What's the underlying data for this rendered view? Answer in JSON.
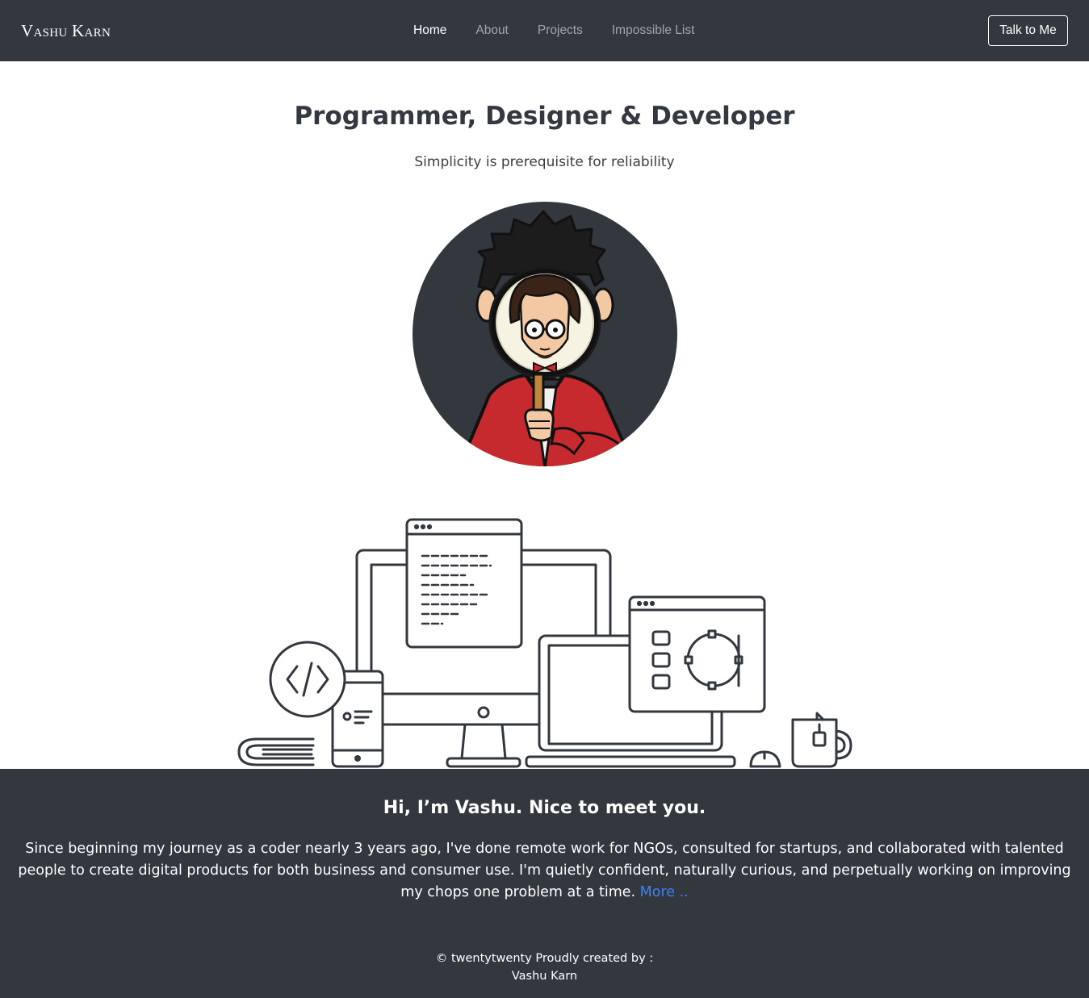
{
  "navbar": {
    "brand": "Vashu Karn",
    "links": [
      {
        "label": "Home",
        "active": true
      },
      {
        "label": "About",
        "active": false
      },
      {
        "label": "Projects",
        "active": false
      },
      {
        "label": "Impossible List",
        "active": false
      }
    ],
    "cta_label": "Talk to Me"
  },
  "hero": {
    "title": "Programmer, Designer & Developer",
    "subtitle": "Simplicity is prerequisite for reliability",
    "avatar_icon": "avatar-illustration",
    "illustration_icon": "devices-illustration"
  },
  "about": {
    "title": "Hi, I’m Vashu. Nice to meet you.",
    "text": "Since beginning my journey as a coder nearly 3 years ago, I've done remote work for NGOs, consulted for startups, and collaborated with talented people to create digital products for both business and consumer use. I'm quietly confident, naturally curious, and perpetually working on improving my chops one problem at a time. ",
    "more_label": "More .."
  },
  "footer": {
    "line1": "© twentytwenty Proudly created by :",
    "line2": "Vashu Karn"
  },
  "colors": {
    "dark": "#33373e",
    "text": "#333841",
    "link": "#3b82f6",
    "jacket": "#c62a2f"
  }
}
